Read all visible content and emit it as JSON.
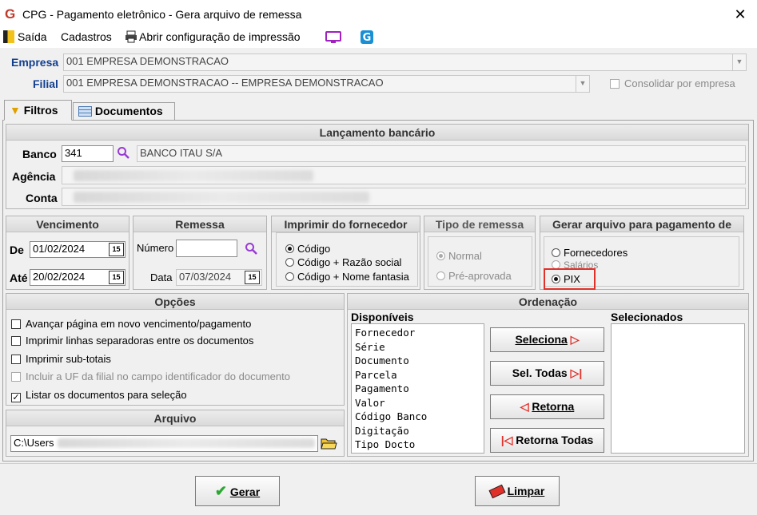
{
  "window": {
    "title": "CPG -  Pagamento eletrônico - Gera arquivo de remessa",
    "close": "✕",
    "logo": "G"
  },
  "toolbar": {
    "saida": "Saída",
    "cadastros": "Cadastros",
    "abrir_config": "Abrir configuração de impressão"
  },
  "header": {
    "empresa_label": "Empresa",
    "empresa_value": "001 EMPRESA DEMONSTRACAO",
    "filial_label": "Filial",
    "filial_value": "001 EMPRESA DEMONSTRACAO -- EMPRESA DEMONSTRACAO",
    "consolidar_label": "Consolidar por empresa"
  },
  "tabs": [
    {
      "label": "Filtros",
      "active": true
    },
    {
      "label": "Documentos",
      "active": false
    }
  ],
  "lancamento": {
    "header": "Lançamento bancário",
    "banco_label": "Banco",
    "banco_code": "341",
    "banco_name": "BANCO ITAU S/A",
    "agencia_label": "Agência",
    "conta_label": "Conta"
  },
  "vencimento": {
    "header": "Vencimento",
    "de_label": "De",
    "de_value": "01/02/2024",
    "ate_label": "Até",
    "ate_value": "20/02/2024",
    "cal_label": "15"
  },
  "remessa": {
    "header": "Remessa",
    "numero_label": "Número",
    "numero_value": "",
    "data_label": "Data",
    "data_value": "07/03/2024"
  },
  "imprimir": {
    "header": "Imprimir do fornecedor",
    "options": [
      "Código",
      "Código + Razão social",
      "Código + Nome fantasia"
    ],
    "selected": 0
  },
  "tipo_remessa": {
    "header": "Tipo de remessa",
    "options": [
      "Normal",
      "Pré-aprovada"
    ],
    "selected": 0
  },
  "gerar_arquivo": {
    "header": "Gerar arquivo para pagamento de",
    "options": [
      "Fornecedores",
      "Salários",
      "PIX"
    ],
    "selected": 2,
    "highlight_color": "#e0302a"
  },
  "opcoes": {
    "header": "Opções",
    "items": [
      {
        "label": "Avançar página em novo vencimento/pagamento",
        "checked": false,
        "disabled": false
      },
      {
        "label": "Imprimir linhas separadoras entre os documentos",
        "checked": false,
        "disabled": false
      },
      {
        "label": "Imprimir sub-totais",
        "checked": false,
        "disabled": false
      },
      {
        "label": "Incluir a UF da filial no campo identificador do documento",
        "checked": false,
        "disabled": true
      },
      {
        "label": "Listar os documentos para seleção",
        "checked": true,
        "disabled": false
      }
    ]
  },
  "arquivo": {
    "header": "Arquivo",
    "path_prefix": "C:\\Users"
  },
  "ordenacao": {
    "header": "Ordenação",
    "disponiveis_label": "Disponíveis",
    "selecionados_label": "Selecionados",
    "disponiveis": [
      "Fornecedor",
      "Série",
      "Documento",
      "Parcela",
      "Pagamento",
      "Valor",
      "Código Banco",
      "Digitação",
      "Tipo Docto"
    ],
    "selecionados": [],
    "buttons": {
      "seleciona": "Seleciona",
      "sel_todas": "Sel. Todas",
      "retorna": "Retorna",
      "retorna_todas": "Retorna Todas"
    }
  },
  "footer": {
    "gerar": "Gerar",
    "limpar": "Limpar"
  }
}
